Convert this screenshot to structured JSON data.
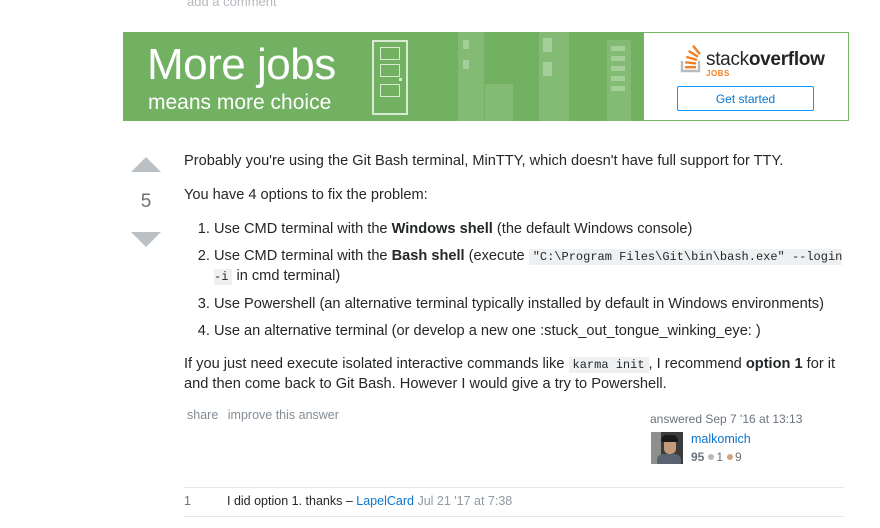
{
  "add_comment": "add a comment",
  "banner": {
    "headline": "More jobs",
    "subhead": "means more choice",
    "brand_word_light": "stack",
    "brand_word_bold": "overflow",
    "brand_sub": "JOBS",
    "cta": "Get started",
    "colors": {
      "green": "#72b062",
      "orange": "#f48024",
      "button_border": "#0a95ff"
    }
  },
  "vote": {
    "count": "5"
  },
  "answer": {
    "p1": "Probably you're using the Git Bash terminal, MinTTY, which doesn't have full support for TTY.",
    "p2": "You have 4 options to fix the problem:",
    "list": {
      "i1_pre": "Use CMD terminal with the ",
      "i1_bold": "Windows shell",
      "i1_post": " (the default Windows console)",
      "i2_pre": "Use CMD terminal with the ",
      "i2_bold": "Bash shell",
      "i2_mid": " (execute ",
      "i2_code": "\"C:\\Program Files\\Git\\bin\\bash.exe\" --login -i",
      "i2_post": " in cmd terminal)",
      "i3": "Use Powershell (an alternative terminal typically installed by default in Windows environments)",
      "i4": "Use an alternative terminal (or develop a new one :stuck_out_tongue_winking_eye: )"
    },
    "p3_pre": "If you just need execute isolated interactive commands like ",
    "p3_code": "karma init",
    "p3_mid": ", I recommend ",
    "p3_bold": "option 1",
    "p3_post": " for it and then come back to Git Bash. However I would give a try to Powershell."
  },
  "menu": {
    "share": "share",
    "improve": "improve this answer"
  },
  "user": {
    "answered": "answered Sep 7 '16 at 13:13",
    "name": "malkomich",
    "rep": "95",
    "silver": "1",
    "bronze": "9",
    "silver_color": "#b4b8bc",
    "bronze_color": "#d1a684"
  },
  "comment": {
    "score": "1",
    "text": "I did option 1. thanks – ",
    "user": "LapelCard",
    "date": "Jul 21 '17 at 7:38"
  }
}
